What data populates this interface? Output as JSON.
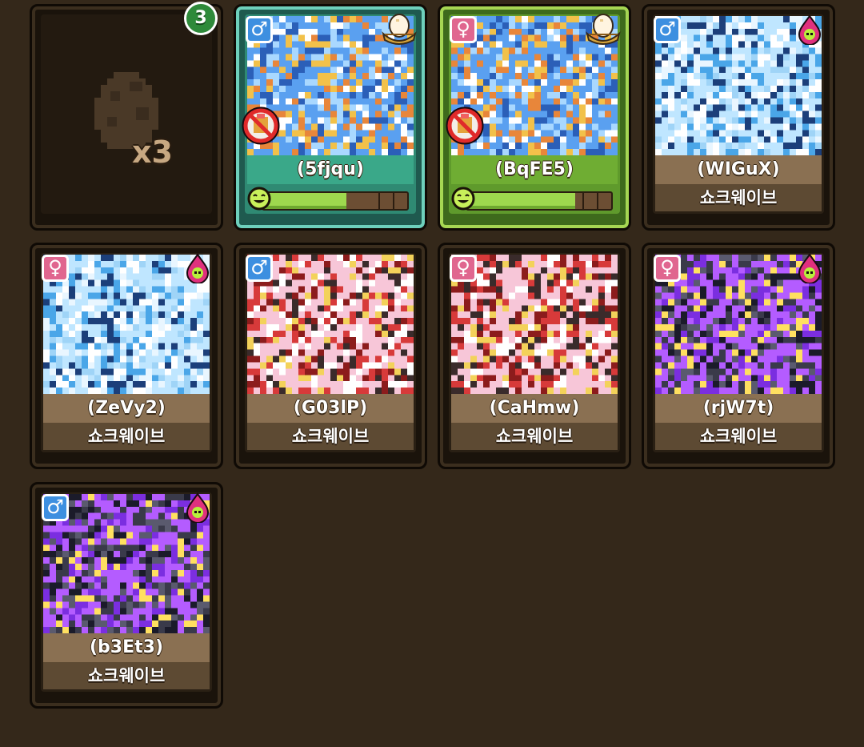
{
  "egg_slot": {
    "badge_count": "3",
    "quantity_label": "x3"
  },
  "colors": {
    "male": "#3d8fe0",
    "female": "#e0668f",
    "highlight_blue": "#6ed0bc",
    "highlight_green": "#a6d653",
    "background": "#34281a"
  },
  "pets": [
    {
      "name": "(5fjqu)",
      "gender": "male",
      "gender_symbol": "♂",
      "highlight": "blue",
      "status_icon": "egg-nest-icon",
      "blocked_icon": "no-breed-icon",
      "happiness": 0.58,
      "art_palette": "blue"
    },
    {
      "name": "(BqFE5)",
      "gender": "female",
      "gender_symbol": "♀",
      "highlight": "green",
      "status_icon": "egg-nest-icon",
      "blocked_icon": "no-breed-icon",
      "happiness": 0.75,
      "art_palette": "blue"
    },
    {
      "name": "(WIGuX)",
      "skill": "쇼크웨이브",
      "gender": "male",
      "gender_symbol": "♂",
      "element_icon": "dark-element-icon",
      "art_palette": "ice"
    },
    {
      "name": "(ZeVy2)",
      "skill": "쇼크웨이브",
      "gender": "female",
      "gender_symbol": "♀",
      "element_icon": "dark-element-icon",
      "art_palette": "ice"
    },
    {
      "name": "(G03lP)",
      "skill": "쇼크웨이브",
      "gender": "male",
      "gender_symbol": "♂",
      "art_palette": "fire"
    },
    {
      "name": "(CaHmw)",
      "skill": "쇼크웨이브",
      "gender": "female",
      "gender_symbol": "♀",
      "art_palette": "fire"
    },
    {
      "name": "(rjW7t)",
      "skill": "쇼크웨이브",
      "gender": "female",
      "gender_symbol": "♀",
      "element_icon": "dark-element-icon",
      "art_palette": "shadow"
    },
    {
      "name": "(b3Et3)",
      "skill": "쇼크웨이브",
      "gender": "male",
      "gender_symbol": "♂",
      "element_icon": "dark-element-icon",
      "art_palette": "shadow"
    }
  ]
}
